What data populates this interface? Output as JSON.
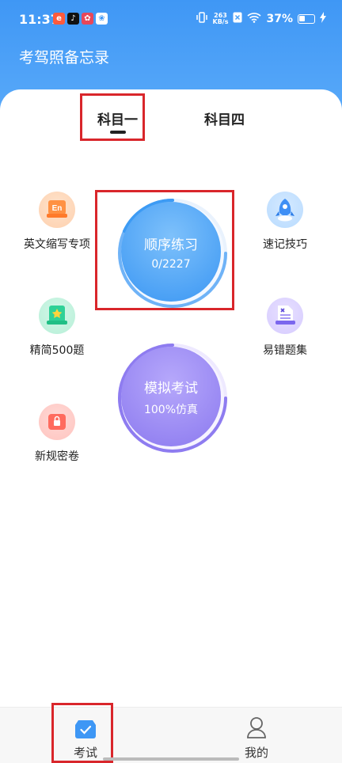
{
  "status_bar": {
    "time": "11:37",
    "net_speed_value": "263",
    "net_speed_unit": "KB/s",
    "battery": "37%"
  },
  "app": {
    "title": "考驾照备忘录"
  },
  "tabs": [
    {
      "label": "科目一",
      "active": true
    },
    {
      "label": "科目四",
      "active": false
    }
  ],
  "features_left": [
    {
      "label": "英文缩写专项",
      "icon": "en-icon",
      "badge": "En"
    },
    {
      "label": "精简500题",
      "icon": "star-box-icon"
    },
    {
      "label": "新规密卷",
      "icon": "lock-folder-icon"
    }
  ],
  "features_right": [
    {
      "label": "速记技巧",
      "icon": "rocket-icon"
    },
    {
      "label": "易错题集",
      "icon": "mistake-doc-icon"
    }
  ],
  "sequential_practice": {
    "title": "顺序练习",
    "progress": "0/2227"
  },
  "mock_exam": {
    "title": "模拟考试",
    "subtitle": "100%仿真"
  },
  "bottom_nav": [
    {
      "label": "考试",
      "icon": "exam-check-icon",
      "active": true
    },
    {
      "label": "我的",
      "icon": "person-icon",
      "active": false
    }
  ],
  "colors": {
    "header_blue": "#3f97f5",
    "practice_blue": "#3d9bf4",
    "exam_purple": "#8e7cf0",
    "highlight_red": "#d9262b"
  }
}
